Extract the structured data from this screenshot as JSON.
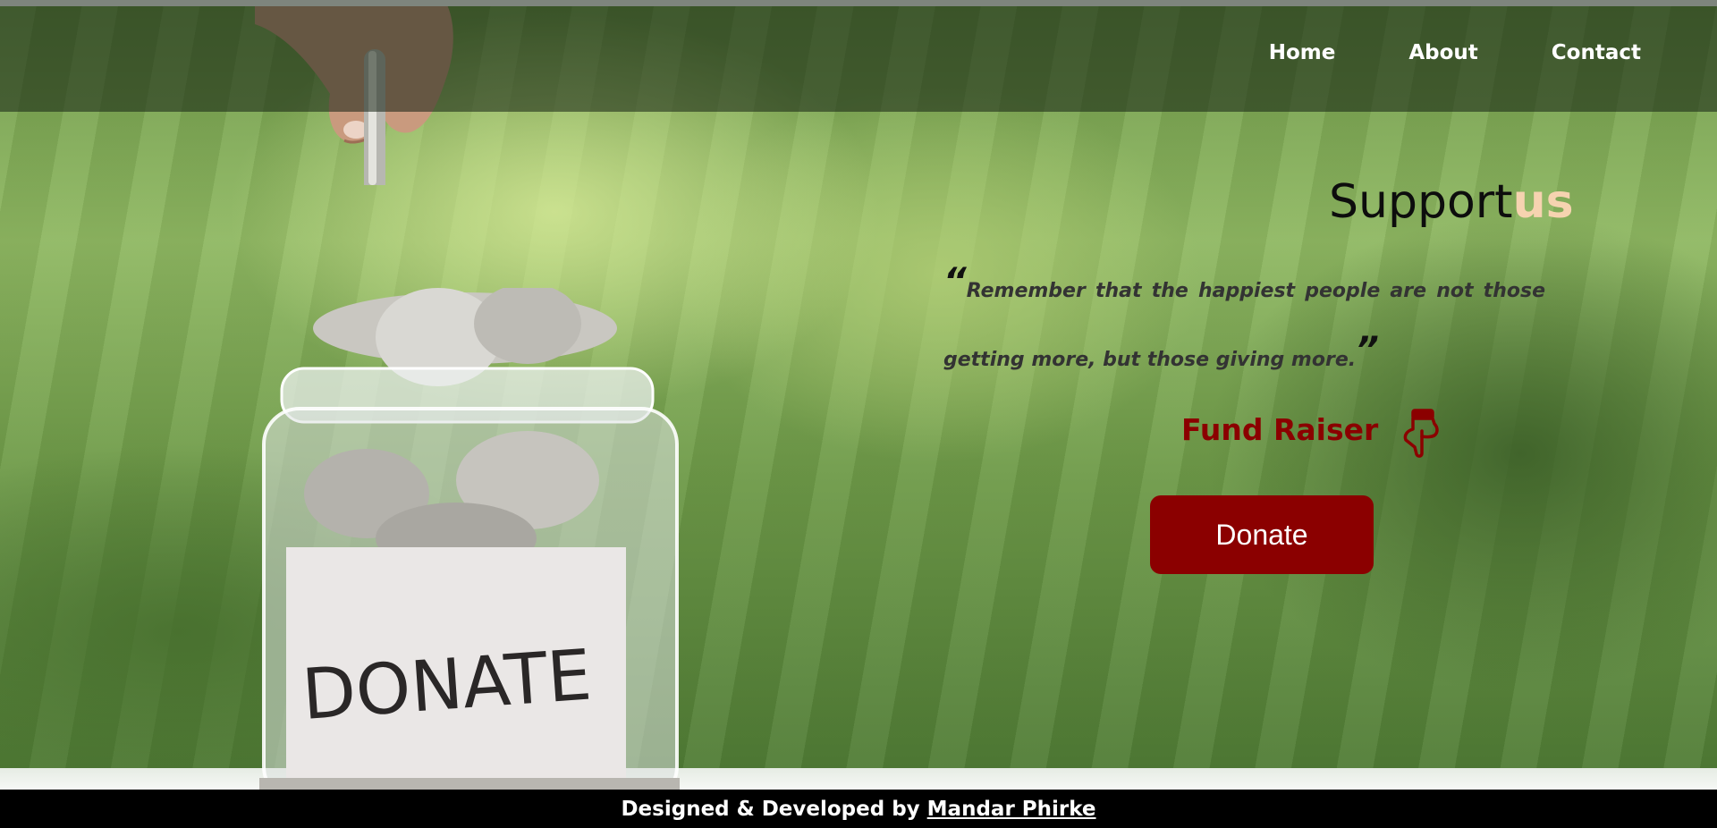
{
  "nav": {
    "items": [
      {
        "label": "Home"
      },
      {
        "label": "About"
      },
      {
        "label": "Contact"
      }
    ]
  },
  "hero": {
    "image_alt": "Hand dropping coin into donation jar",
    "jar_label": "DONATE"
  },
  "support": {
    "title_main": "Support",
    "title_accent": "us",
    "quote_open": "“",
    "quote_text": "Remember that the happiest people are not those getting more, but those giving more.",
    "quote_close": "”"
  },
  "fund": {
    "label": "Fund Raiser",
    "icon": "pointing-down-hand-icon"
  },
  "donate": {
    "label": "Donate"
  },
  "footer": {
    "credit": "Designed & Developed by",
    "author": "Mandar Phirke"
  },
  "colors": {
    "accent": "#8b0000",
    "title_accent": "#f6d3b0",
    "footer_bg": "#000000"
  }
}
